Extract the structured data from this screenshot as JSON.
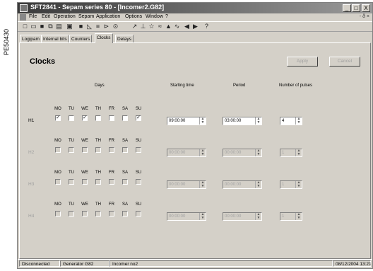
{
  "side_label": "PE50430",
  "window": {
    "title": "SFT2841 - Sepam series 80 - [Incomer2.G82]",
    "buttons": [
      "_",
      "□",
      "X"
    ]
  },
  "menu": [
    "File",
    "Edit",
    "Operation",
    "Sepam",
    "Application",
    "Options",
    "Window",
    "?"
  ],
  "mdi_controls": "- ð ×",
  "toolbar_icons": [
    "new-icon",
    "open-icon",
    "save-icon",
    "copy-icon",
    "paste-icon",
    "print-icon",
    "save-icon",
    "preview-icon",
    "settings-icon",
    "connect-icon",
    "pst-icon",
    "tool-icon",
    "tool-icon",
    "tool-icon",
    "tool-icon",
    "tool-icon",
    "tool-icon",
    "arrow-left-icon",
    "arrow-right-icon",
    "help-icon"
  ],
  "tabs": [
    "Logipam",
    "Internal bits",
    "Counters",
    "Clocks",
    "Delays"
  ],
  "active_tab": "Clocks",
  "panel": {
    "title": "Clocks",
    "apply_label": "Apply",
    "cancel_label": "Cancel"
  },
  "headers": {
    "days": "Days",
    "starting_time": "Starting time",
    "period": "Period",
    "pulses": "Number of pulses"
  },
  "day_names": [
    "MO",
    "TU",
    "WE",
    "TH",
    "FR",
    "SA",
    "SU"
  ],
  "clocks": [
    {
      "label": "H1",
      "enabled": true,
      "days": [
        true,
        false,
        true,
        false,
        false,
        false,
        true
      ],
      "start": "09:00:00",
      "period": "03:00:00",
      "pulses": "4"
    },
    {
      "label": "H2",
      "enabled": false,
      "days": [
        false,
        false,
        false,
        false,
        false,
        false,
        false
      ],
      "start": "00:00:00",
      "period": "00:00:00",
      "pulses": "1"
    },
    {
      "label": "H3",
      "enabled": false,
      "days": [
        false,
        false,
        false,
        false,
        false,
        false,
        false
      ],
      "start": "00:00:00",
      "period": "00:00:00",
      "pulses": "1"
    },
    {
      "label": "H4",
      "enabled": false,
      "days": [
        false,
        false,
        false,
        false,
        false,
        false,
        false
      ],
      "start": "00:00:00",
      "period": "00:00:00",
      "pulses": "1"
    }
  ],
  "status": {
    "connection": "Disconnected",
    "generator": "Generator G82",
    "incomer": "Incomer no2",
    "datetime": "08/12/2004  13:21"
  },
  "colors": {
    "face": "#d4d0c8",
    "title_start": "#3a3a3a",
    "title_end": "#9a9a9a"
  }
}
